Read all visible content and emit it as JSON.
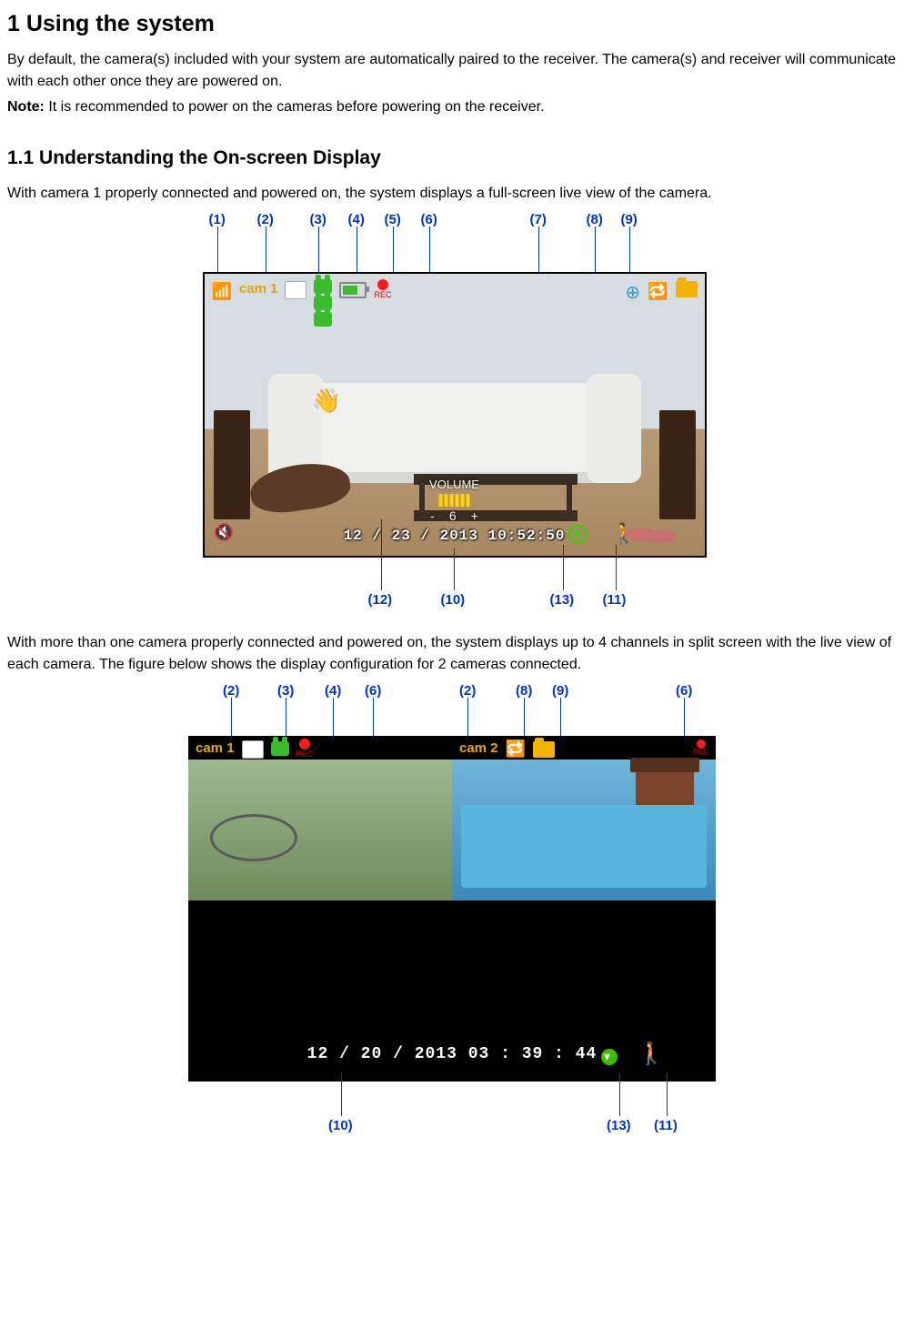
{
  "h1": "1 Using the system",
  "p1": "By default, the camera(s) included with your system are automatically paired to the receiver. The camera(s) and receiver will communicate with each other once they are powered on.",
  "note_label": "Note:",
  "note_text": " It is recommended to power on the cameras before powering on the receiver.",
  "h2": "1.1 Understanding the On-screen Display",
  "p2": "With camera 1 properly connected and powered on, the system displays a full-screen live view of the camera.",
  "p3": "With more than one camera properly connected and powered on, the system displays up to 4 channels in split screen with the live view of each camera. The figure below shows the display configuration for 2 cameras connected.",
  "fig1": {
    "callouts": {
      "c1": "(1)",
      "c2": "(2)",
      "c3": "(3)",
      "c4": "(4)",
      "c5": "(5)",
      "c6": "(6)",
      "c7": "(7)",
      "c8": "(8)",
      "c9": "(9)",
      "c10": "(10)",
      "c11": "(11)",
      "c12": "(12)",
      "c13": "(13)"
    },
    "cam_label": "cam 1",
    "rec_label": "REC",
    "volume_label": "VOLUME",
    "volume_value": "6",
    "vol_minus": "-",
    "vol_plus": "+",
    "timestamp": "12 / 23 / 2013  10:52:50",
    "mute": "🔇"
  },
  "fig2": {
    "callouts": {
      "c2a": "(2)",
      "c3": "(3)",
      "c4": "(4)",
      "c6a": "(6)",
      "c2b": "(2)",
      "c8": "(8)",
      "c9": "(9)",
      "c6b": "(6)",
      "c10": "(10)",
      "c11": "(11)",
      "c13": "(13)"
    },
    "cam1_label": "cam 1",
    "cam2_label": "cam 2",
    "rec_label": "REC",
    "timestamp": "12 / 20 / 2013      03 : 39 : 44"
  }
}
